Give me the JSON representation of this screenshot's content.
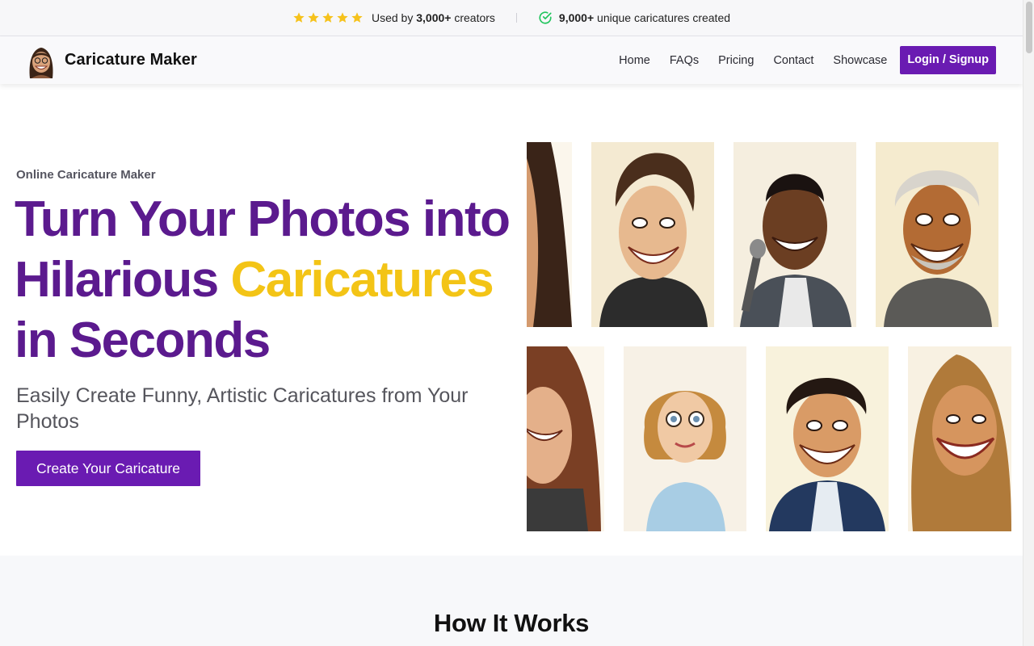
{
  "topbar": {
    "rating_icon": "star-icon",
    "star_count": 5,
    "used_by_prefix": "Used by ",
    "used_by_count": "3,000+",
    "used_by_suffix": " creators",
    "created_icon": "check-circle-icon",
    "created_count": "9,000+",
    "created_suffix": " unique caricatures created"
  },
  "navbar": {
    "brand_name": "Caricature Maker",
    "items": [
      {
        "label": "Home"
      },
      {
        "label": "FAQs"
      },
      {
        "label": "Pricing"
      },
      {
        "label": "Contact"
      },
      {
        "label": "Showcase"
      }
    ],
    "login_label": "Login / Signup"
  },
  "hero": {
    "eyebrow": "Online Caricature Maker",
    "title_line1": "Turn Your Photos into",
    "title_line2_a": "Hilarious ",
    "title_line2_accent": "Caricatures",
    "title_line3": "in Seconds",
    "subtitle": "Easily Create Funny, Artistic Caricatures from Your Photos",
    "cta_label": "Create Your Caricature"
  },
  "gallery": {
    "images": [
      {
        "name": "caricature-woman-dark-hair"
      },
      {
        "name": "caricature-man-wavy-hair"
      },
      {
        "name": "caricature-man-microphone"
      },
      {
        "name": "caricature-old-man-gray-hair"
      },
      {
        "name": "caricature-woman-brown-hair"
      },
      {
        "name": "caricature-woman-blonde-bob"
      },
      {
        "name": "caricature-man-dark-curly-hair"
      },
      {
        "name": "caricature-woman-long-blonde-hair"
      }
    ]
  },
  "how_it_works": {
    "heading": "How It Works"
  },
  "colors": {
    "brand_purple": "#6a1bb2",
    "title_purple": "#5b1a8e",
    "accent_yellow": "#f3c416",
    "star_yellow": "#f6c21c",
    "check_green": "#22c55e"
  }
}
